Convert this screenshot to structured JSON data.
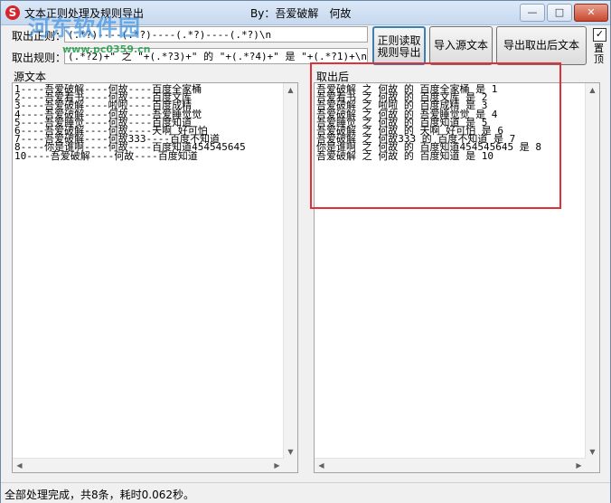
{
  "window": {
    "title": "文本正则处理及规则导出",
    "byline": "By：吾爱破解　何故",
    "minimize": "—",
    "maximize": "□",
    "close": "✕"
  },
  "watermark": {
    "text": "河东软件园",
    "url": "www.pc0359.cn"
  },
  "rules": {
    "regex_label": "取出正则：",
    "regex_value": "(.*?)----(.*?)----(.*?)----(.*?)\\n",
    "output_label": "取出规则：",
    "output_value": "(.*?2)+\" 之 \"+(.*?3)+\" 的 \"+(.*?4)+\" 是 \"+(.*?1)+\\n"
  },
  "buttons": {
    "regex_read_line1": "正则读取",
    "regex_read_line2": "规则导出",
    "import_source": "导入源文本",
    "export_result": "导出取出后文本"
  },
  "options": {
    "checkbox_mark": "✓",
    "side_label": "置顶"
  },
  "source": {
    "label": "源文本",
    "lines": [
      "1----吾爱破解----何故----百度全家桶",
      "2----吾爱看书----何故----百度文库",
      "3----吾爱破解----啦啦----百度成精",
      "4----吾爱破解----何故----吾爱睡觉觉",
      "5----吾爱睡觉----何故----百度知道",
      "6----吾爱破解----何故----天啊 好可怕",
      "7----吾爱破解----何故333----百度不知道",
      "8----你是谁啊----何故----百度知道454545645",
      "10----吾爱破解----何故----百度知道"
    ]
  },
  "result": {
    "label": "取出后",
    "lines": [
      "吾爱破解 之 何故 的 百度全家桶 是 1",
      "吾爱看书 之 何故 的 百度文库 是 2",
      "吾爱破解 之 啦啦 的 百度成精 是 3",
      "吾爱破解 之 何故 的 吾爱睡觉觉 是 4",
      "吾爱睡觉 之 何故 的 百度知道 是 5",
      "吾爱破解 之 何故 的 天啊 好可怕 是 6",
      "吾爱破解 之 何故333 的 百度不知道 是 7",
      "你是谁啊 之 何故 的 百度知道454545645 是 8",
      "吾爱破解 之 何故 的 百度知道 是 10"
    ]
  },
  "status": {
    "text": "全部处理完成，共8条，耗时0.062秒。"
  },
  "colors": {
    "highlight_border": "#e0313b",
    "title_bar": "#c7d9ef"
  }
}
